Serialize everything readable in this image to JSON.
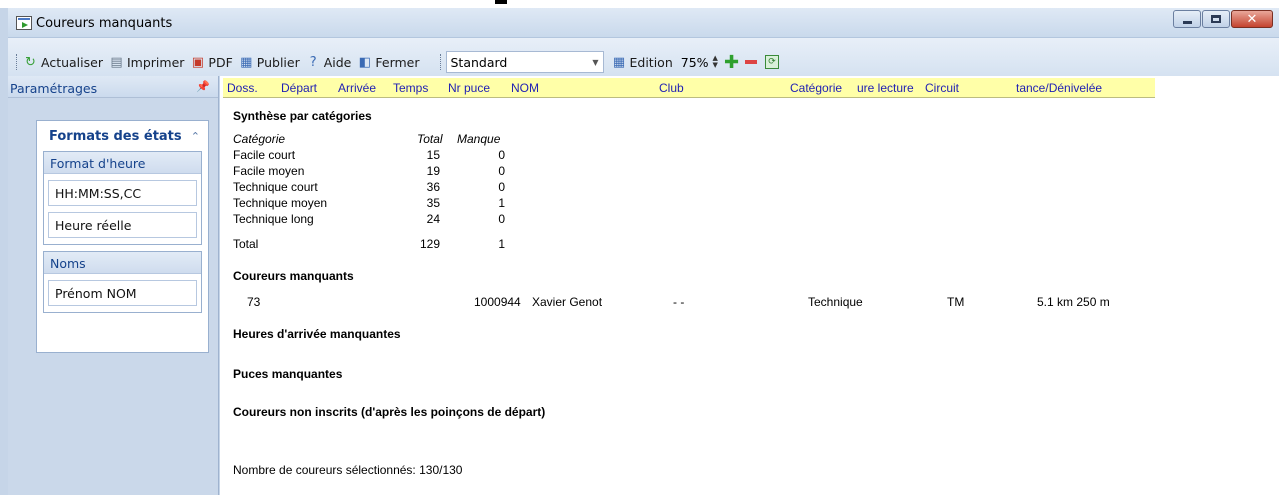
{
  "window": {
    "title": "Coureurs manquants"
  },
  "toolbar": {
    "actualiser": "Actualiser",
    "imprimer": "Imprimer",
    "pdf": "PDF",
    "publier": "Publier",
    "aide": "Aide",
    "fermer": "Fermer",
    "style_select": "Standard",
    "edition": "Edition",
    "zoom": "75%"
  },
  "left_panel": {
    "title": "Paramétrages",
    "group_title": "Formats des états",
    "sections": [
      {
        "title": "Format d'heure",
        "items": [
          "HH:MM:SS,CC",
          "Heure réelle"
        ]
      },
      {
        "title": "Noms",
        "items": [
          "Prénom NOM"
        ]
      }
    ]
  },
  "report": {
    "columns": [
      "Doss.",
      "Départ",
      "Arrivée",
      "Temps",
      "Nr puce",
      "NOM",
      "Club",
      "Catégorie",
      "ure lecture",
      "Circuit",
      "tance/Dénivelée"
    ],
    "summary_title": "Synthèse par catégories",
    "summary_header": {
      "category": "Catégorie",
      "total": "Total",
      "missing": "Manque"
    },
    "summary_rows": [
      {
        "category": "Facile court",
        "total": "15",
        "missing": "0"
      },
      {
        "category": "Facile moyen",
        "total": "19",
        "missing": "0"
      },
      {
        "category": "Technique court",
        "total": "36",
        "missing": "0"
      },
      {
        "category": "Technique moyen",
        "total": "35",
        "missing": "1"
      },
      {
        "category": "Technique long",
        "total": "24",
        "missing": "0"
      }
    ],
    "summary_total": {
      "label": "Total",
      "total": "129",
      "missing": "1"
    },
    "missing_runners_title": "Coureurs manquants",
    "missing_runners": [
      {
        "bib": "73",
        "chip": "1000944",
        "name": "Xavier Genot",
        "club": "- -",
        "category": "Technique",
        "circuit": "TM",
        "distance": "5.1 km  250 m"
      }
    ],
    "missing_finish_title": "Heures d'arrivée manquantes",
    "missing_chips_title": "Puces manquantes",
    "unregistered_title": "Coureurs non inscrits (d'après les poinçons de départ)",
    "footer": "Nombre de coureurs sélectionnés:  130/130"
  },
  "colors": {
    "header_bg": "#ffffa8",
    "header_text": "#1f1fb4",
    "panel_accent": "#15428b"
  }
}
